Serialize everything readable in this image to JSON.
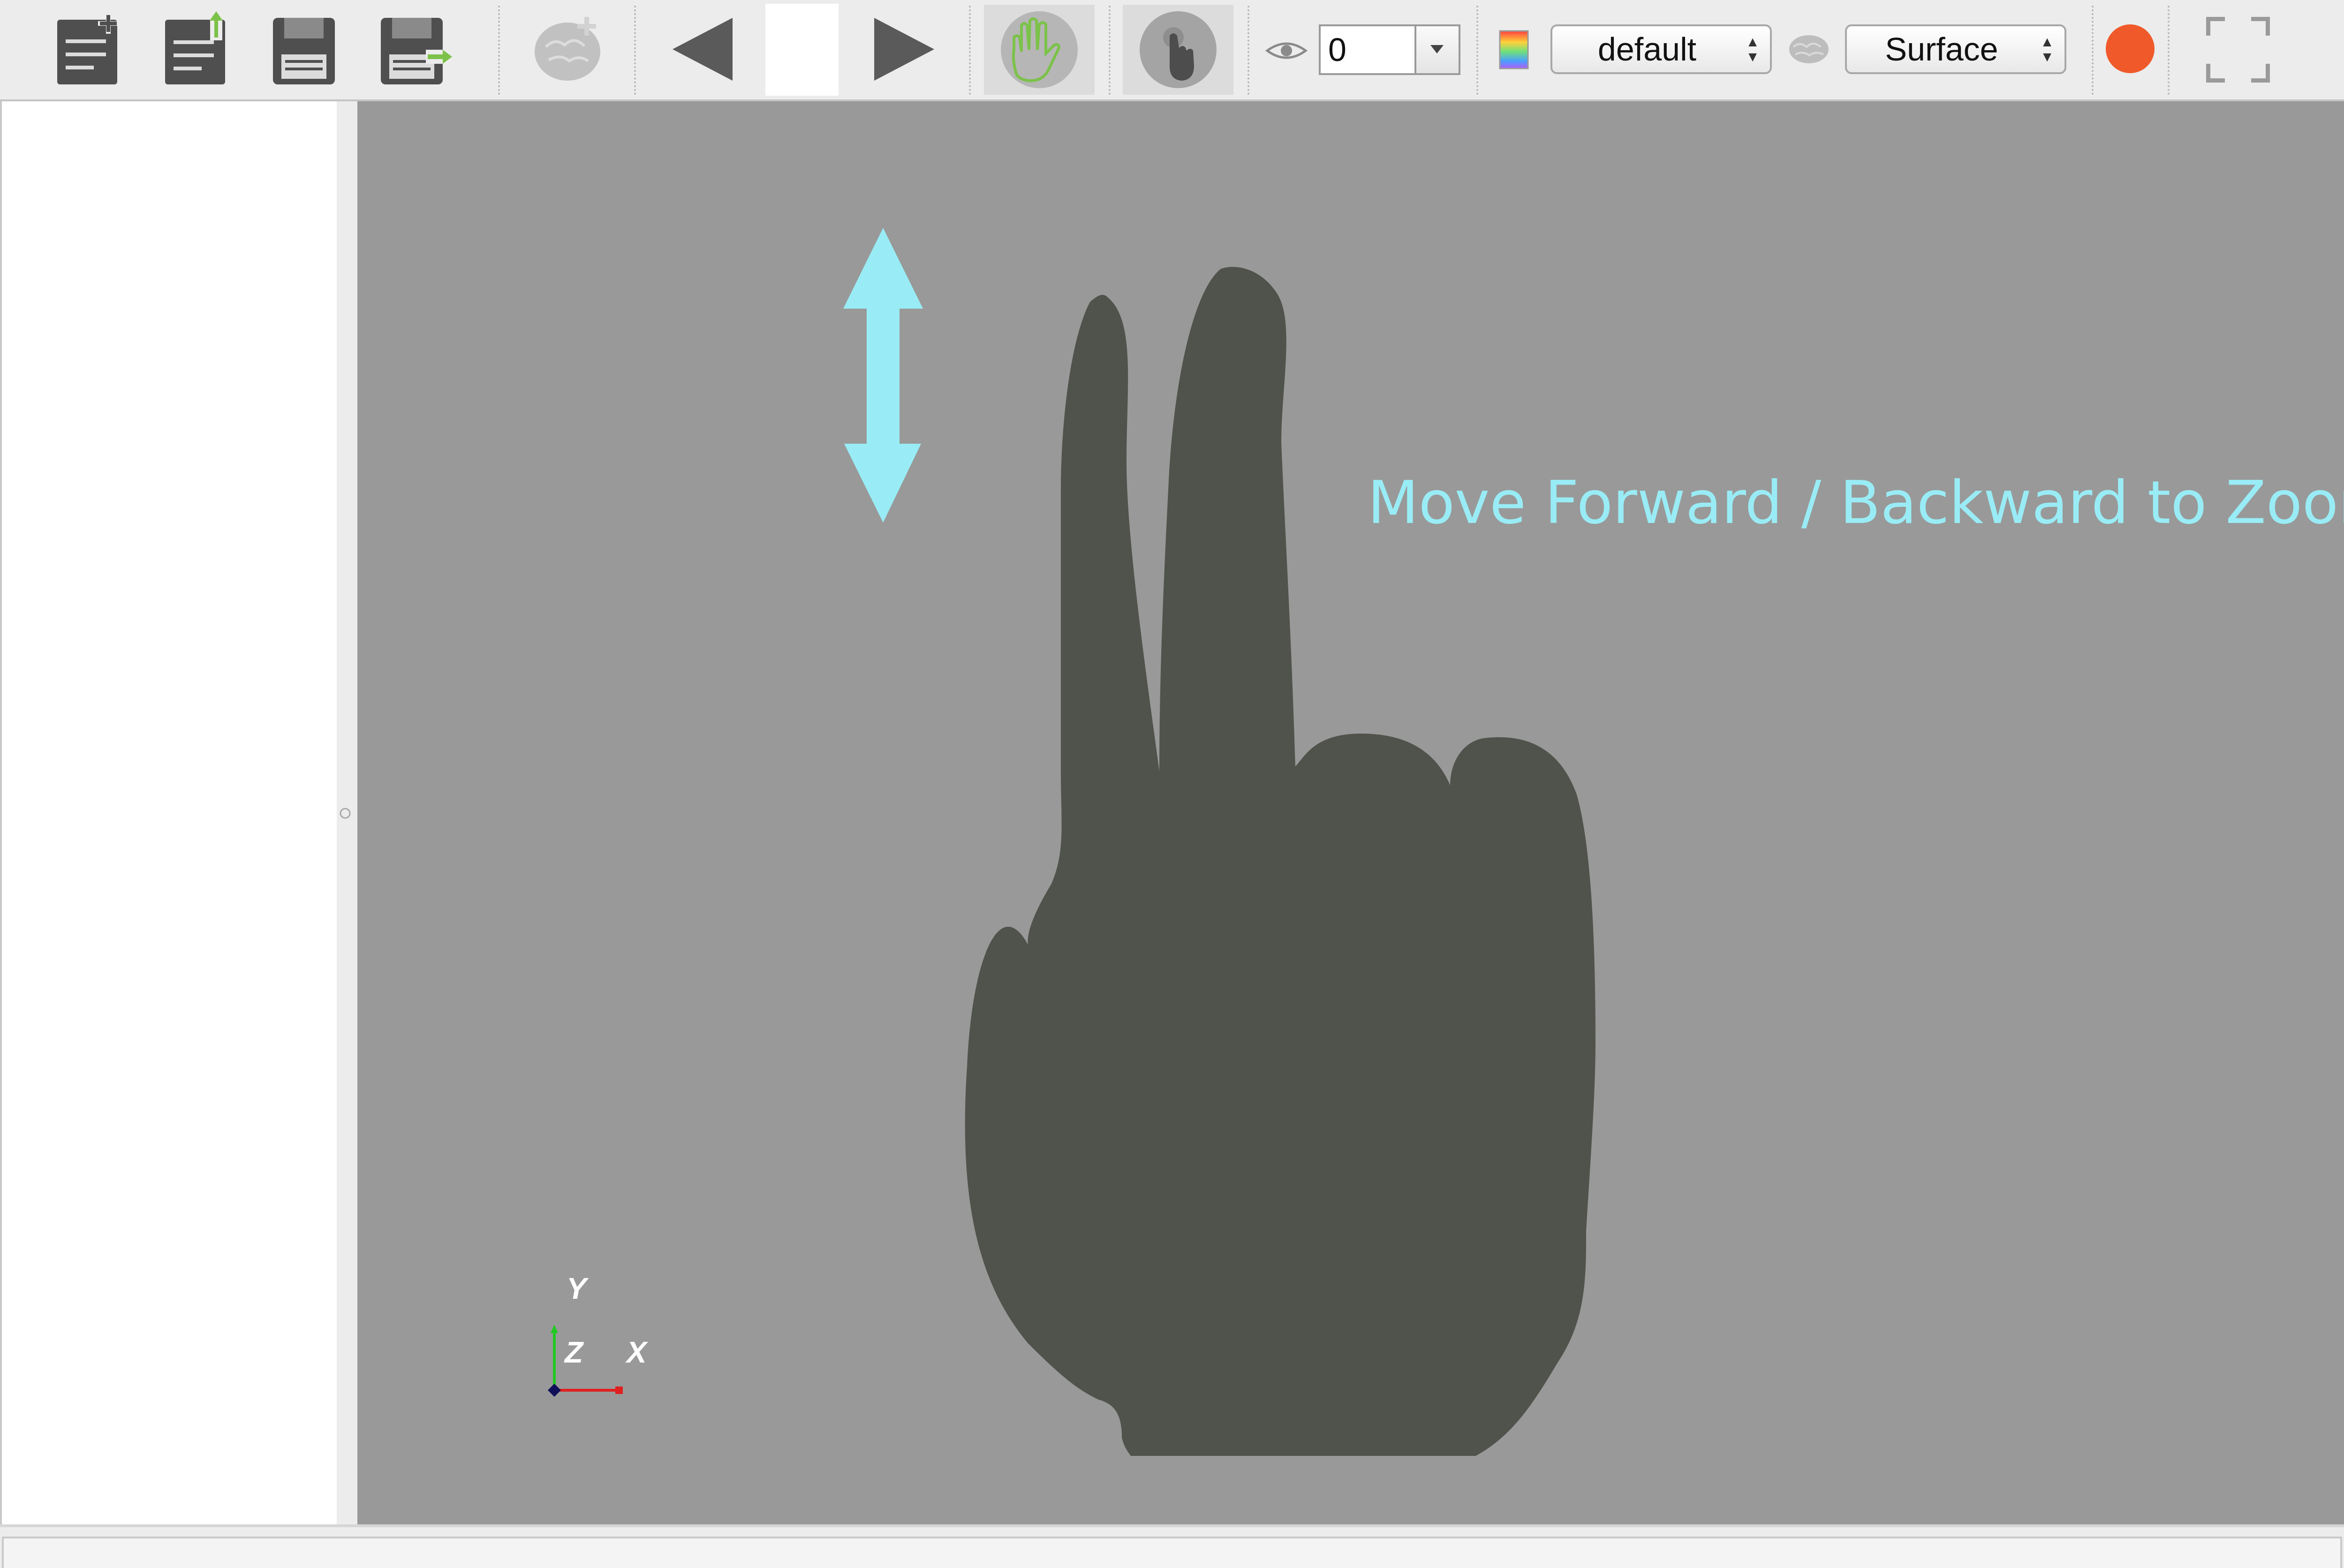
{
  "toolbar": {
    "buttons": [
      {
        "icon": "new-document-icon"
      },
      {
        "icon": "open-document-icon"
      },
      {
        "icon": "save-icon"
      },
      {
        "icon": "save-as-icon"
      },
      {
        "icon": "add-brain-icon"
      },
      {
        "icon": "previous-arrow-icon"
      },
      {
        "icon": "next-arrow-icon"
      },
      {
        "icon": "hand-gesture-mode-icon"
      },
      {
        "icon": "touch-mode-icon"
      }
    ],
    "visibility_icon": "eye-icon",
    "frame_value": "0",
    "colormap_icon": "color-gradient-icon",
    "colormap_select": "default",
    "surface_icon": "brain-icon",
    "surface_select": "Surface",
    "record_icon": "record-icon",
    "fullscreen_icon": "fullscreen-icon",
    "colors": {
      "record": "#f05a2a",
      "hand_active_green": "#7cc24a"
    }
  },
  "viewport": {
    "background": "#999999",
    "hint_text": "Move Forward / Backward to Zoom",
    "hint_color": "#99ecf5",
    "hand_color": "#50534b",
    "axes": {
      "y_label": "Y",
      "z_label": "Z",
      "x_label": "X"
    }
  }
}
